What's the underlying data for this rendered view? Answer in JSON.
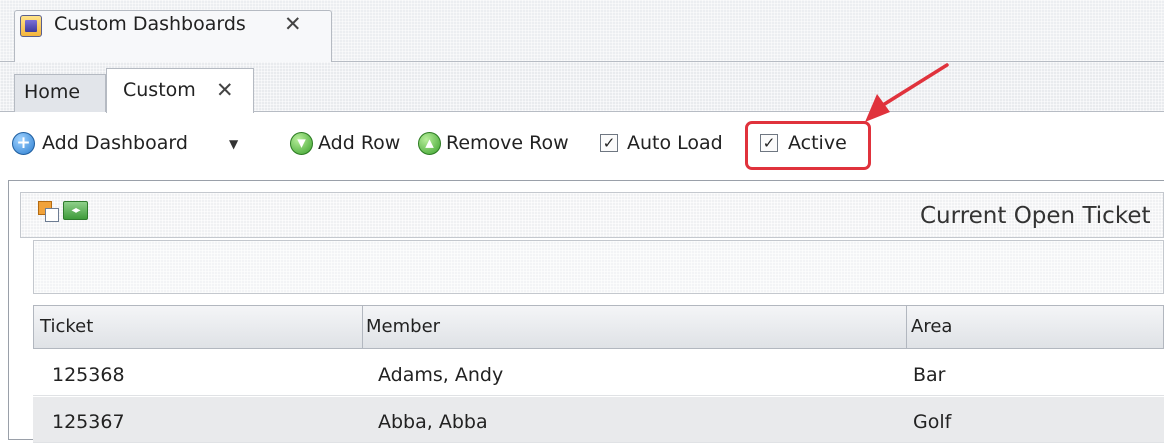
{
  "window": {
    "doc_tab": {
      "label": "Custom Dashboards",
      "icon": "dashboard-app-icon",
      "close_glyph": "✕"
    }
  },
  "tabs": [
    {
      "label": "Home",
      "active": false
    },
    {
      "label": "Custom",
      "active": true,
      "close_glyph": "✕"
    }
  ],
  "toolbar": {
    "add_dashboard": {
      "label": "Add Dashboard",
      "icon": "plus-circle-icon",
      "dropdown": true
    },
    "add_row": {
      "label": "Add Row",
      "icon": "down-arrow-circle-icon"
    },
    "remove_row": {
      "label": "Remove Row",
      "icon": "up-arrow-circle-icon"
    },
    "auto_load": {
      "label": "Auto Load",
      "checked": true
    },
    "active": {
      "label": "Active",
      "checked": true
    }
  },
  "annotation": {
    "color": "#e0323c"
  },
  "panel": {
    "title": "Current Open Ticket",
    "icons": [
      "windows-icon",
      "resize-icon"
    ]
  },
  "grid": {
    "columns": [
      "Ticket",
      "Member",
      "Area"
    ],
    "rows": [
      {
        "ticket": "125368",
        "member": "Adams, Andy",
        "area": "Bar"
      },
      {
        "ticket": "125367",
        "member": "Abba, Abba",
        "area": "Golf"
      }
    ]
  }
}
